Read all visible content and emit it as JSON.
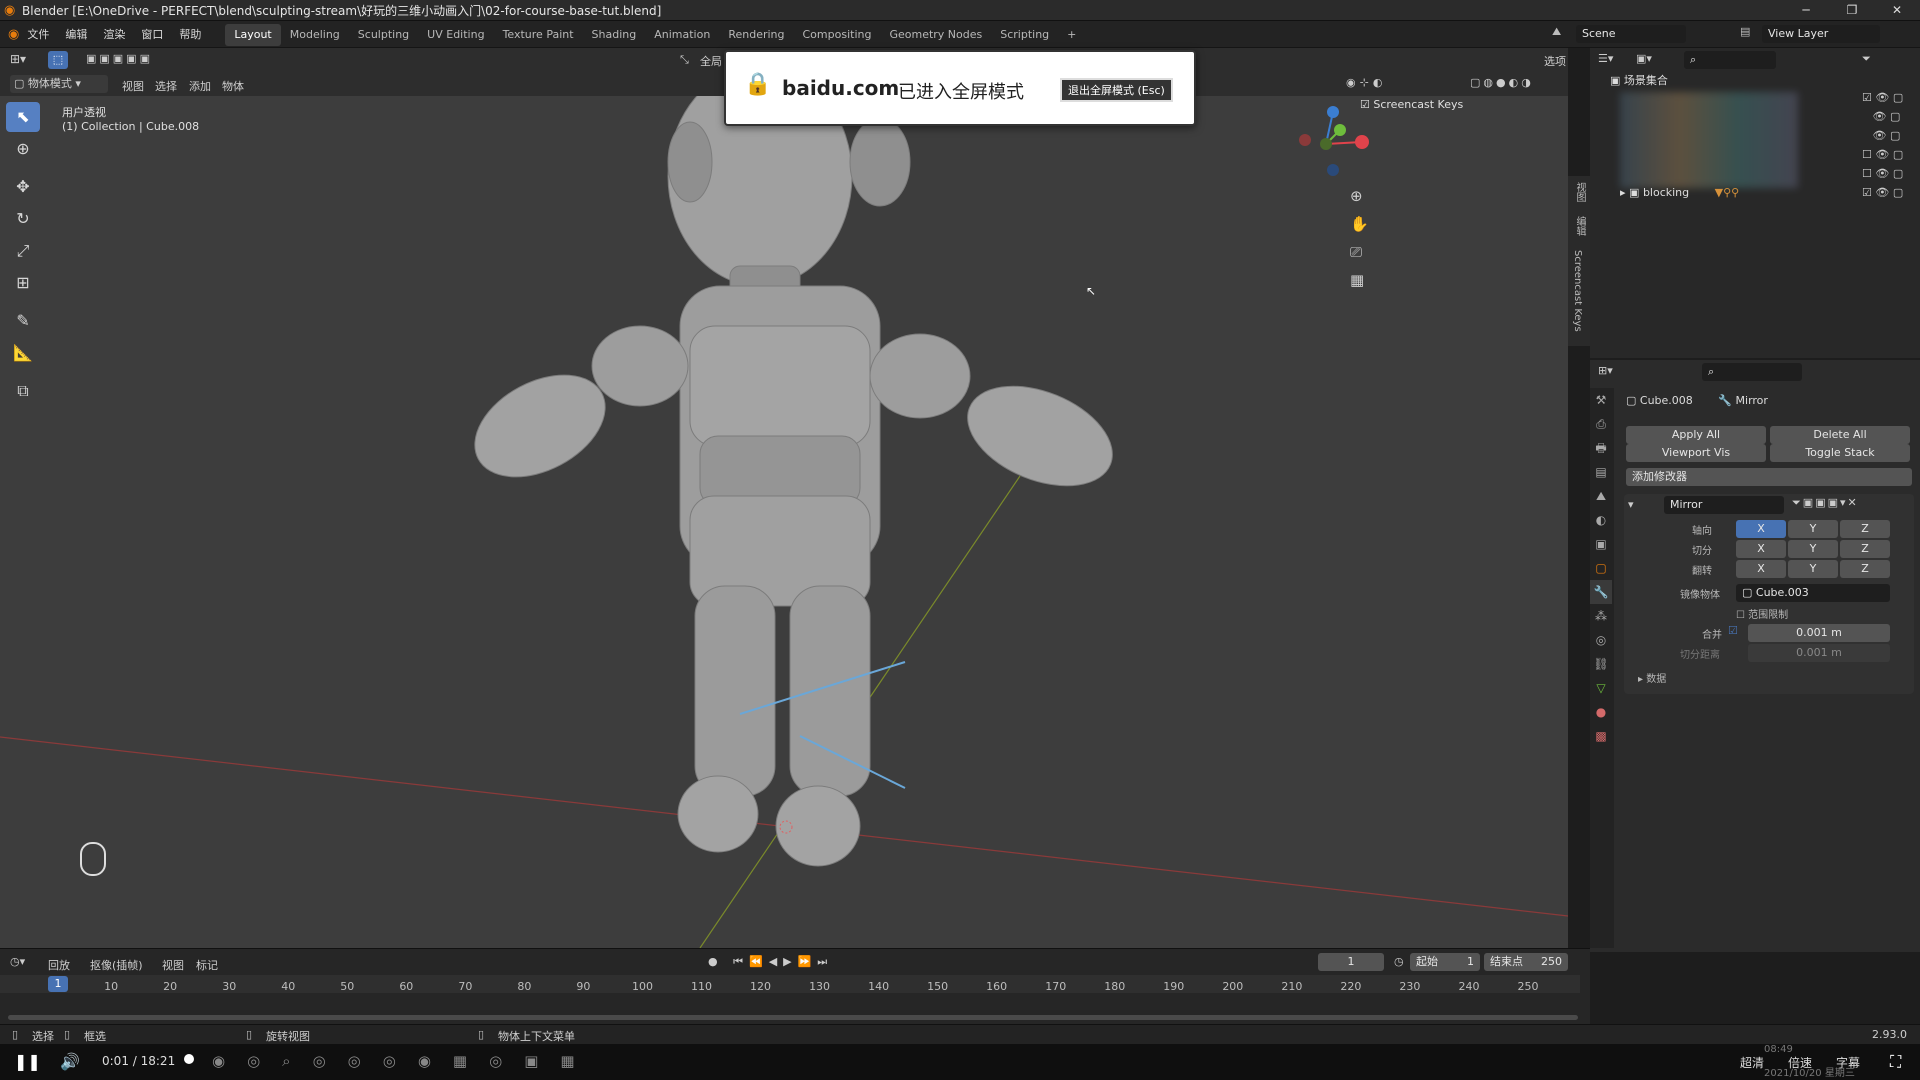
{
  "window": {
    "title": "Blender [E:\\OneDrive - PERFECT\\blend\\sculpting-stream\\好玩的三维小动画入门\\02-for-course-base-tut.blend]",
    "min": "─",
    "max": "❐",
    "close": "✕"
  },
  "menus": [
    "文件",
    "编辑",
    "渲染",
    "窗口",
    "帮助"
  ],
  "workspaces": [
    "Layout",
    "Modeling",
    "Sculpting",
    "UV Editing",
    "Texture Paint",
    "Shading",
    "Animation",
    "Rendering",
    "Compositing",
    "Geometry Nodes",
    "Scripting"
  ],
  "active_workspace": "Layout",
  "add_tab": "+",
  "scene": {
    "name": "Scene",
    "view_layer": "View Layer"
  },
  "viewport": {
    "mode": "物体模式",
    "header_menus": [
      "视图",
      "选择",
      "添加",
      "物体"
    ],
    "view_name": "用户透视",
    "collection_info": "(1) Collection | Cube.008",
    "global_label": "全局",
    "options_label": "选项",
    "screencast_label": "Screencast Keys",
    "gizmo_axes": [
      "X",
      "Y",
      "Z"
    ]
  },
  "fullscreen_banner": {
    "domain": "baidu.com",
    "message": "已进入全屏模式",
    "exit_button": "退出全屏模式 (Esc)"
  },
  "side_tabs": [
    "视图",
    "编辑",
    "Screencast Keys"
  ],
  "outliner": {
    "root": "场景集合",
    "item": "blocking"
  },
  "properties": {
    "object": "Cube.008",
    "modifier": "Mirror",
    "apply_all": "Apply All",
    "delete_all": "Delete All",
    "viewport_vis": "Viewport Vis",
    "toggle_stack": "Toggle Stack",
    "add_modifier": "添加修改器",
    "mod_name": "Mirror",
    "rows": [
      {
        "label": "轴向",
        "x": "X",
        "y": "Y",
        "z": "Z"
      },
      {
        "label": "切分",
        "x": "X",
        "y": "Y",
        "z": "Z"
      },
      {
        "label": "翻转",
        "x": "X",
        "y": "Y",
        "z": "Z"
      }
    ],
    "mirror_obj_label": "镜像物体",
    "mirror_obj": "Cube.003",
    "clip_label": "范围限制",
    "merge_label": "合并",
    "merge_value": "0.001 m",
    "bisect_label": "切分距离",
    "bisect_value": "0.001 m",
    "data_label": "数据"
  },
  "timeline": {
    "menus": [
      "回放",
      "抠像(插帧)",
      "视图",
      "标记"
    ],
    "current_frame": "1",
    "start_label": "起始",
    "start": "1",
    "end_label": "结束点",
    "end": "250",
    "ticks": [
      "1",
      "10",
      "20",
      "30",
      "40",
      "50",
      "60",
      "70",
      "80",
      "90",
      "100",
      "110",
      "120",
      "130",
      "140",
      "150",
      "160",
      "170",
      "180",
      "190",
      "200",
      "210",
      "220",
      "230",
      "240",
      "250"
    ]
  },
  "statusbar": {
    "select": "选择",
    "box": "框选",
    "rotate": "旋转视图",
    "context": "物体上下文菜单",
    "version": "2.93.0"
  },
  "video": {
    "time": "0:01 / 18:21",
    "quality": "超清",
    "speed": "倍速",
    "subtitle": "字幕",
    "clock": "08:49",
    "date": "2021/10/20 星期三",
    "progress": 0.001
  },
  "colors": {
    "accent": "#4772b3",
    "active_tool": "#5680c2",
    "axis_x": "#e0434b",
    "axis_y": "#6ebd3c",
    "axis_z": "#3b7ed1"
  }
}
